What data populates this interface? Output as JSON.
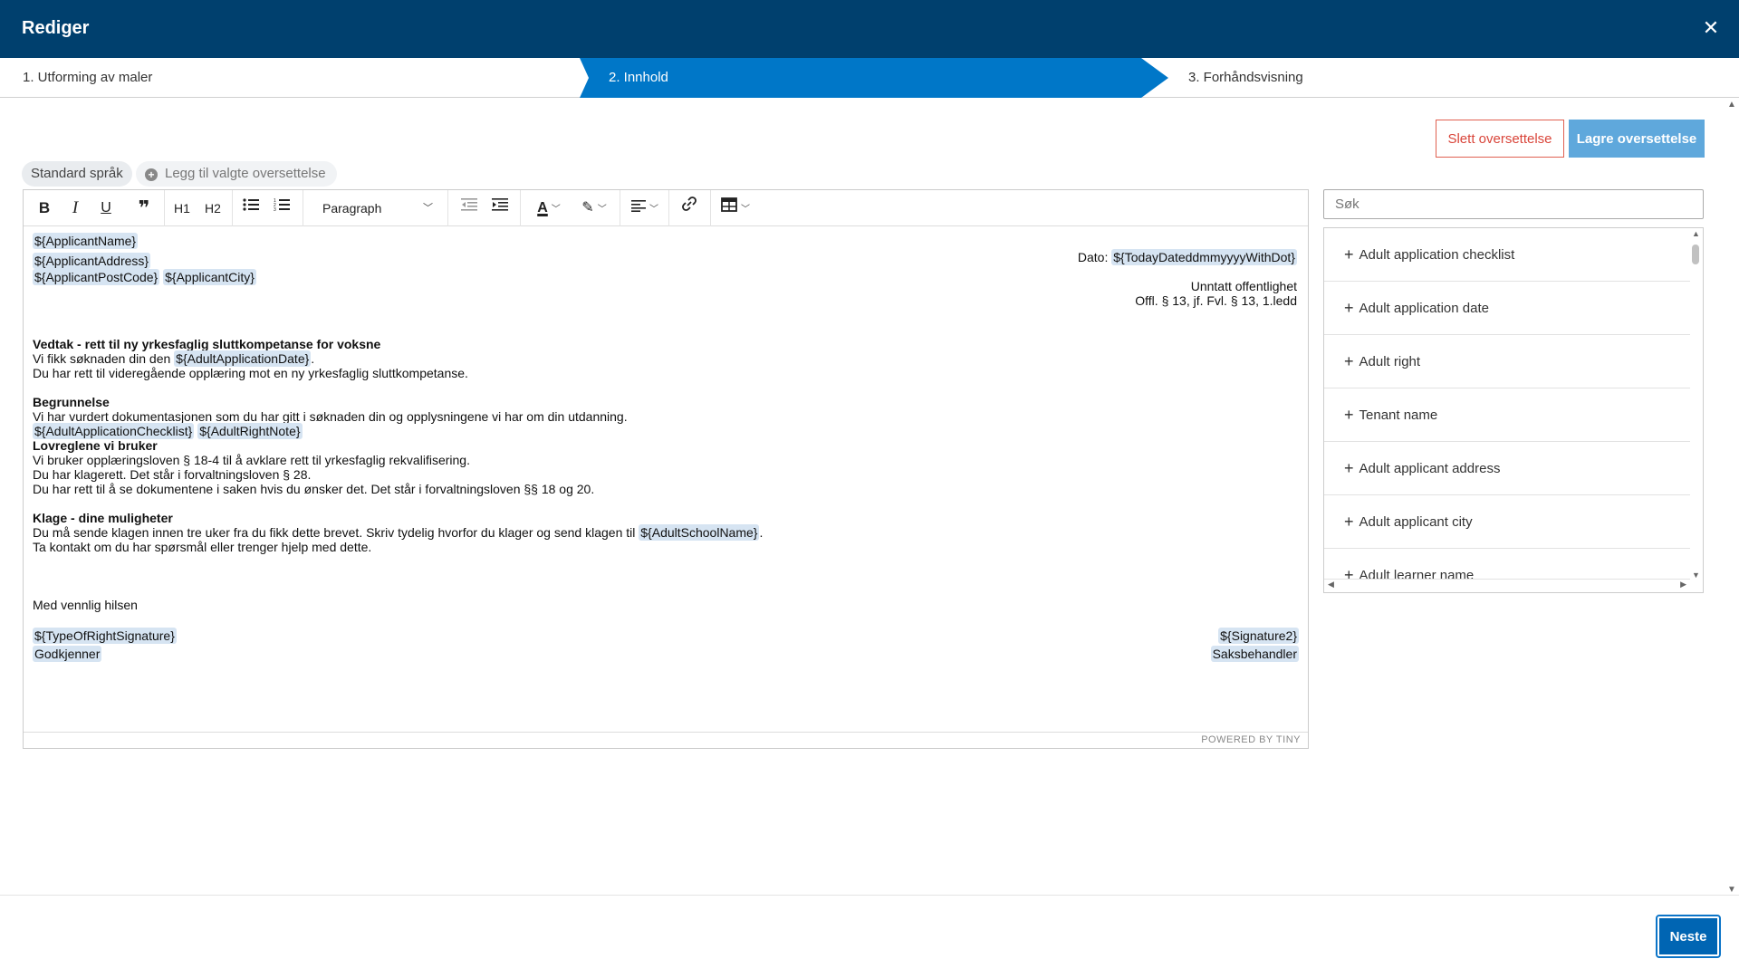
{
  "header": {
    "title": "Rediger",
    "close_icon": "close-icon"
  },
  "stepper": {
    "steps": [
      {
        "label": "1. Utforming av maler",
        "active": false
      },
      {
        "label": "2. Innhold",
        "active": true
      },
      {
        "label": "3. Forhåndsvisning",
        "active": false
      }
    ],
    "active_color": "#0077c8"
  },
  "actions": {
    "delete_label": "Slett oversettelse",
    "save_label": "Lagre oversettelse"
  },
  "languages": {
    "standard_label": "Standard språk",
    "add_label": "Legg til valgte oversettelse"
  },
  "toolbar": {
    "h1": "H1",
    "h2": "H2",
    "block_format": "Paragraph"
  },
  "letter": {
    "applicant_name": "${ApplicantName}",
    "applicant_address": "${ApplicantAddress}",
    "applicant_postcode": "${ApplicantPostCode}",
    "applicant_city": "${ApplicantCity}",
    "date_label": "Dato:",
    "date_field": "${TodayDateddmmyyyyWithDot}",
    "exempt": "Unntatt offentlighet",
    "offl": "Offl. § 13, jf. Fvl. § 13, 1.ledd",
    "heading1": "Vedtak - rett til ny yrkesfaglig sluttkompetanse for voksne",
    "p1_prefix": "Vi fikk søknaden din den",
    "p1_field": "${AdultApplicationDate}",
    "p1_suffix": ".",
    "p2": "Du har rett til videregående opplæring mot en ny yrkesfaglig sluttkompetanse.",
    "heading2": "Begrunnelse",
    "p3": "Vi har vurdert dokumentasjonen som du har gitt i søknaden din og opplysningene vi har om din utdanning.",
    "checklist_field": "${AdultApplicationChecklist}",
    "rightnote_field": "${AdultRightNote}",
    "heading3": "Lovreglene vi bruker",
    "p4": "Vi bruker opplæringsloven § 18-4 til å avklare rett til yrkesfaglig rekvalifisering.",
    "p5": "Du har klagerett. Det står i forvaltningsloven § 28.",
    "p6": "Du har rett til å se dokumentene i saken hvis du ønsker det. Det står i forvaltningsloven §§ 18 og 20.",
    "heading4": "Klage - dine muligheter",
    "p7_prefix": "Du må sende klagen innen tre uker fra du fikk dette brevet. Skriv tydelig hvorfor du klager og send klagen til",
    "p7_field": "${AdultSchoolName}",
    "p7_suffix": ".",
    "p8": "Ta kontakt om du har spørsmål eller trenger hjelp med dette.",
    "closing": "Med vennlig hilsen",
    "sig1_field": "${TypeOfRightSignature}",
    "sig1_role": "Godkjenner",
    "sig2_field": "${Signature2}",
    "sig2_role": "Saksbehandler"
  },
  "editor_status": "POWERED BY TINY",
  "search": {
    "placeholder": "Søk"
  },
  "fields_list": [
    "Adult application checklist",
    "Adult application date",
    "Adult right",
    "Tenant name",
    "Adult applicant address",
    "Adult applicant city",
    "Adult learner name"
  ],
  "footer": {
    "next_label": "Neste"
  }
}
